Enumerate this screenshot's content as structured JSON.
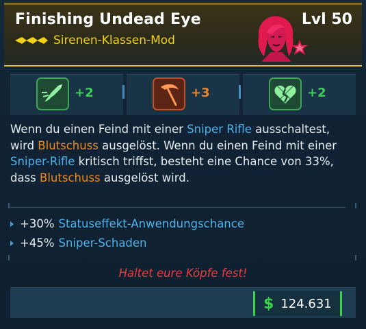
{
  "item": {
    "name": "Finishing Undead Eye",
    "level": "Lvl 50",
    "type": "Sirenen-Klassen-Mod",
    "rarity_color": "#f3d21b",
    "portrait_icon": "siren-portrait-icon"
  },
  "skills": [
    {
      "icon": "rocket-dash-icon",
      "value": "+2",
      "color": "#3ccf5a",
      "frame": "#2f8a44"
    },
    {
      "icon": "scythe-icon",
      "value": "+3",
      "color": "#f0842a",
      "frame": "#b0461d"
    },
    {
      "icon": "broken-heart-icon",
      "value": "+2",
      "color": "#3ccf5a",
      "frame": "#2f8a44"
    }
  ],
  "description": {
    "p1": "Wenn du einen Feind mit einer ",
    "k1": "Sniper Rifle",
    "p2": " ausschaltest, wird ",
    "k2": "Blutschuss",
    "p3": " ausgelöst. Wenn du einen Feind mit einer ",
    "k3": "Sniper-Rifle",
    "p4": " kritisch triffst, besteht eine Chance von 33%, dass ",
    "k4": "Blutschuss",
    "p5": " ausgelöst wird."
  },
  "bonuses": [
    {
      "value": "+30%",
      "name": "Statuseffekt-Anwendungschance"
    },
    {
      "value": "+45%",
      "name": "Sniper-Schaden"
    }
  ],
  "flavor_text": "Haltet eure Köpfe fest!",
  "price": {
    "currency_icon": "$",
    "value": "124.631",
    "color": "#39d24a"
  }
}
